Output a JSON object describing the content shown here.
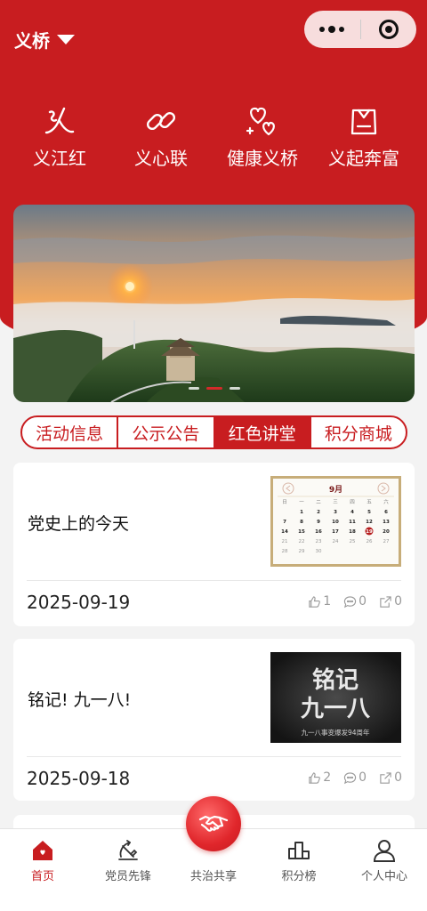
{
  "header": {
    "location": "义桥"
  },
  "features": [
    {
      "icon": "river-icon",
      "label": "义江红"
    },
    {
      "icon": "link-icon",
      "label": "义心联"
    },
    {
      "icon": "hearts-icon",
      "label": "健康义桥"
    },
    {
      "icon": "bag-icon",
      "label": "义起奔富"
    }
  ],
  "tabs": [
    {
      "label": "活动信息",
      "active": false
    },
    {
      "label": "公示公告",
      "active": false
    },
    {
      "label": "红色讲堂",
      "active": true
    },
    {
      "label": "积分商城",
      "active": false
    }
  ],
  "articles": [
    {
      "title": "党史上的今天",
      "date": "2025-09-19",
      "likes": "1",
      "comments": "0",
      "shares": "0",
      "calendar": {
        "month": "9月",
        "weekdays": [
          "日",
          "一",
          "二",
          "三",
          "四",
          "五",
          "六"
        ],
        "rows": [
          [
            "",
            "1",
            "2",
            "3",
            "4",
            "5",
            "6"
          ],
          [
            "7",
            "8",
            "9",
            "10",
            "11",
            "12",
            "13"
          ],
          [
            "14",
            "15",
            "16",
            "17",
            "18",
            "19",
            "20"
          ],
          [
            "21",
            "22",
            "23",
            "24",
            "25",
            "26",
            "27"
          ],
          [
            "28",
            "29",
            "30",
            "",
            "",
            "",
            ""
          ]
        ],
        "highlight": "19"
      }
    },
    {
      "title": "铭记! 九一八!",
      "date": "2025-09-18",
      "likes": "2",
      "comments": "0",
      "shares": "0",
      "poster": {
        "line1": "铭记",
        "line2": "九一八",
        "caption": "九一八事变爆发94周年"
      }
    }
  ],
  "tabbar": [
    {
      "icon": "home-icon",
      "label": "首页",
      "active": true
    },
    {
      "icon": "party-emblem-icon",
      "label": "党员先锋",
      "active": false
    },
    {
      "icon": "handshake-icon",
      "label": "共治共享",
      "active": false
    },
    {
      "icon": "ranking-icon",
      "label": "积分榜",
      "active": false
    },
    {
      "icon": "user-icon",
      "label": "个人中心",
      "active": false
    }
  ],
  "colors": {
    "primary": "#c81d20",
    "white": "#ffffff",
    "muted": "#9a9a9a"
  }
}
